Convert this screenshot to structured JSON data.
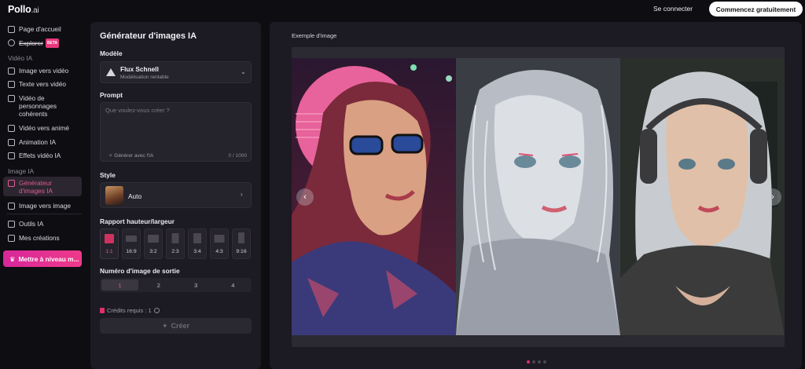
{
  "header": {
    "logo_main": "Pollo",
    "logo_suffix": ".ai",
    "signin": "Se connecter",
    "cta": "Commencez gratuitement"
  },
  "sidebar": {
    "home": "Page d'accueil",
    "explore": "Explorer",
    "beta": "BETA",
    "video_section": "Vidéo IA",
    "video_items": [
      "Image vers vidéo",
      "Texte vers vidéo",
      "Vidéo de personnages cohérents",
      "Vidéo vers animé",
      "Animation IA",
      "Effets vidéo IA"
    ],
    "image_section": "Image IA",
    "image_items": [
      "Générateur d'images IA",
      "Image vers image"
    ],
    "tools": "Outils IA",
    "creations": "Mes créations",
    "upgrade": "Mettre à niveau m..."
  },
  "panel": {
    "title": "Générateur d'images IA",
    "model_label": "Modèle",
    "model_name": "Flux Schnell",
    "model_sub": "Modélisation rentable",
    "prompt_label": "Prompt",
    "prompt_placeholder": "Que voulez-vous créer ?",
    "prompt_generate": "Générer avec l'IA",
    "prompt_count": "0 / 1000",
    "style_label": "Style",
    "style_value": "Auto",
    "ratio_label": "Rapport hauteur/largeur",
    "ratios": [
      "1:1",
      "16:9",
      "3:2",
      "2:3",
      "3:4",
      "4:3",
      "9:16"
    ],
    "ratio_selected": "1:1",
    "output_label": "Numéro d'image de sortie",
    "outputs": [
      "1",
      "2",
      "3",
      "4"
    ],
    "output_selected": "1",
    "credits": "Crédits requis : 1",
    "create": "Créer"
  },
  "main": {
    "title": "Exemple d'image",
    "carousel_active_index": 0,
    "carousel_count": 4
  },
  "colors": {
    "accent": "#e0306a",
    "upgrade": "#e6387d",
    "bg": "#0e0d12",
    "panel": "#1c1a22"
  }
}
